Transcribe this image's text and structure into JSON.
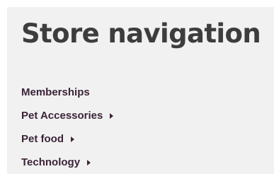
{
  "nav": {
    "title": "Store navigation",
    "items": [
      {
        "label": "Memberships",
        "has_submenu": false
      },
      {
        "label": "Pet Accessories",
        "has_submenu": true,
        "icon": "caret-right-icon"
      },
      {
        "label": "Pet food",
        "has_submenu": true,
        "icon": "caret-right-icon"
      },
      {
        "label": "Technology",
        "has_submenu": true,
        "icon": "caret-right-icon"
      }
    ]
  }
}
